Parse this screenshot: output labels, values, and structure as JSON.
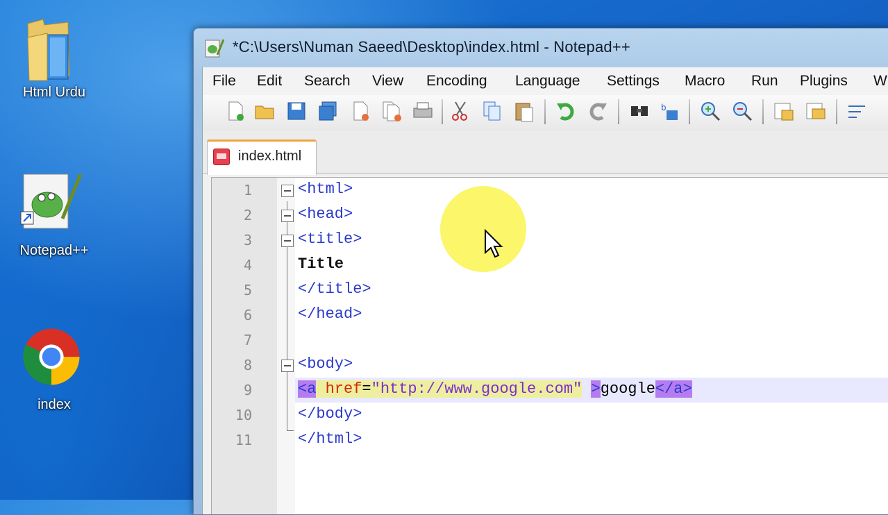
{
  "desktop": {
    "icons": [
      {
        "label": "Html Urdu",
        "icon": "folder-icon"
      },
      {
        "label": "Notepad++",
        "icon": "notepadpp-shortcut-icon"
      },
      {
        "label": "index",
        "icon": "chrome-icon"
      }
    ]
  },
  "window": {
    "title": "*C:\\Users\\Numan Saeed\\Desktop\\index.html - Notepad++",
    "menu": [
      "File",
      "Edit",
      "Search",
      "View",
      "Encoding",
      "Language",
      "Settings",
      "Macro",
      "Run",
      "Plugins",
      "W"
    ],
    "toolbar_icons": [
      "new-file-icon",
      "open-file-icon",
      "save-icon",
      "save-all-icon",
      "close-icon",
      "close-all-icon",
      "print-icon",
      "cut-icon",
      "copy-icon",
      "paste-icon",
      "undo-icon",
      "redo-icon",
      "find-icon",
      "replace-icon",
      "zoom-in-icon",
      "zoom-out-icon",
      "sync-v-icon",
      "sync-h-icon",
      "wrap-icon"
    ],
    "tab": {
      "label": "index.html"
    },
    "lines": [
      {
        "n": "1",
        "text": "<html>"
      },
      {
        "n": "2",
        "text": "<head>"
      },
      {
        "n": "3",
        "text": "<title>"
      },
      {
        "n": "4",
        "text": "Title"
      },
      {
        "n": "5",
        "text": "</title>"
      },
      {
        "n": "6",
        "text": "</head>"
      },
      {
        "n": "7",
        "text": ""
      },
      {
        "n": "8",
        "text": "<body>"
      },
      {
        "n": "9",
        "parts": [
          "<a",
          " ",
          "href",
          "=",
          "\"http://www.google.com\"",
          " ",
          ">",
          "google",
          "</a>"
        ]
      },
      {
        "n": "10",
        "text": "</body>"
      },
      {
        "n": "11",
        "text": "</html>"
      }
    ]
  }
}
